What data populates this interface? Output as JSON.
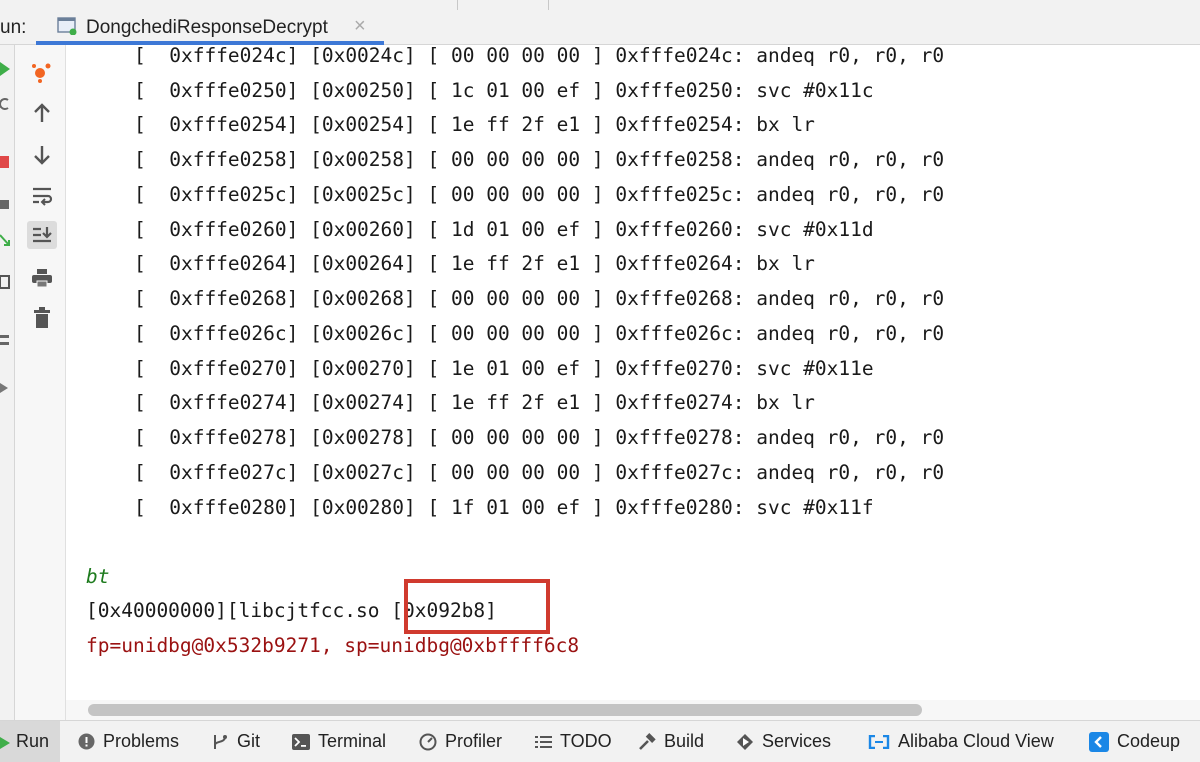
{
  "run_panel": {
    "label": "un:",
    "tab_title": "DongchediResponseDecrypt",
    "tab_close": "×"
  },
  "console": {
    "disasm": [
      "[  0xfffe024c] [0x0024c] [ 00 00 00 00 ] 0xfffe024c: andeq r0, r0, r0",
      "[  0xfffe0250] [0x00250] [ 1c 01 00 ef ] 0xfffe0250: svc #0x11c",
      "[  0xfffe0254] [0x00254] [ 1e ff 2f e1 ] 0xfffe0254: bx lr",
      "[  0xfffe0258] [0x00258] [ 00 00 00 00 ] 0xfffe0258: andeq r0, r0, r0",
      "[  0xfffe025c] [0x0025c] [ 00 00 00 00 ] 0xfffe025c: andeq r0, r0, r0",
      "[  0xfffe0260] [0x00260] [ 1d 01 00 ef ] 0xfffe0260: svc #0x11d",
      "[  0xfffe0264] [0x00264] [ 1e ff 2f e1 ] 0xfffe0264: bx lr",
      "[  0xfffe0268] [0x00268] [ 00 00 00 00 ] 0xfffe0268: andeq r0, r0, r0",
      "[  0xfffe026c] [0x0026c] [ 00 00 00 00 ] 0xfffe026c: andeq r0, r0, r0",
      "[  0xfffe0270] [0x00270] [ 1e 01 00 ef ] 0xfffe0270: svc #0x11e",
      "[  0xfffe0274] [0x00274] [ 1e ff 2f e1 ] 0xfffe0274: bx lr",
      "[  0xfffe0278] [0x00278] [ 00 00 00 00 ] 0xfffe0278: andeq r0, r0, r0",
      "[  0xfffe027c] [0x0027c] [ 00 00 00 00 ] 0xfffe027c: andeq r0, r0, r0",
      "[  0xfffe0280] [0x00280] [ 1f 01 00 ef ] 0xfffe0280: svc #0x11f"
    ],
    "bt_label": "bt",
    "bt_frame": "[0x40000000][libcjtfcc.so [0x092b8]",
    "bt_regs": "fp=unidbg@0x532b9271, sp=unidbg@0xbffff6c8",
    "highlight_color": "#d03a2e"
  },
  "gutter_icons": [
    "rerun-icon",
    "debug-icon",
    "arrow-up-icon",
    "arrow-down-icon",
    "soft-wrap-icon",
    "scroll-to-end-icon",
    "print-icon",
    "trash-icon"
  ],
  "bottom_tools": {
    "run": "Run",
    "problems": "Problems",
    "git": "Git",
    "terminal": "Terminal",
    "profiler": "Profiler",
    "todo": "TODO",
    "build": "Build",
    "services": "Services",
    "alibaba": "Alibaba Cloud View",
    "codeup": "Codeup"
  }
}
